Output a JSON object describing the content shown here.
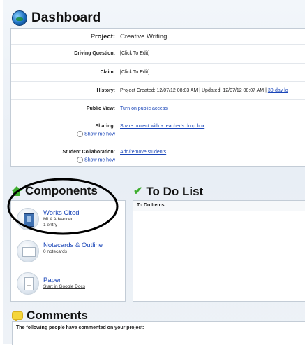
{
  "dashboard": {
    "title": "Dashboard"
  },
  "project_rows": {
    "project": {
      "label": "Project:",
      "value": "Creative Writing"
    },
    "driving_question": {
      "label": "Driving Question:",
      "value": "[Click To Edit]"
    },
    "claim": {
      "label": "Claim:",
      "value": "[Click To Edit]"
    },
    "history": {
      "label": "History:",
      "value": "Project Created: 12/07/12 08:03 AM | Updated: 12/07/12 08:07 AM | ",
      "link": "30-day lo"
    },
    "public_view": {
      "label": "Public View:",
      "link": "Turn on public access"
    },
    "sharing": {
      "label": "Sharing:",
      "link": "Share project with a teacher's drop box",
      "help": "Show me how"
    },
    "collaboration": {
      "label": "Student Collaboration:",
      "link": "Add/remove students",
      "help": "Show me how"
    }
  },
  "components": {
    "title": "Components",
    "items": [
      {
        "name": "Works Cited",
        "sub1": "MLA Advanced",
        "sub2": "1 entry",
        "icon": "book-icon"
      },
      {
        "name": "Notecards & Outline",
        "sub1": "0 notecards",
        "icon": "notecards-icon"
      },
      {
        "name": "Paper",
        "link": "Start in Google Docs",
        "icon": "paper-icon"
      }
    ]
  },
  "todo": {
    "title": "To Do List",
    "header": "To Do Items"
  },
  "comments": {
    "title": "Comments",
    "text": "The following people have commented on your project:"
  },
  "colors": {
    "link": "#1a46b8",
    "accent_green": "#3fae2f",
    "annotation": "#000000"
  }
}
